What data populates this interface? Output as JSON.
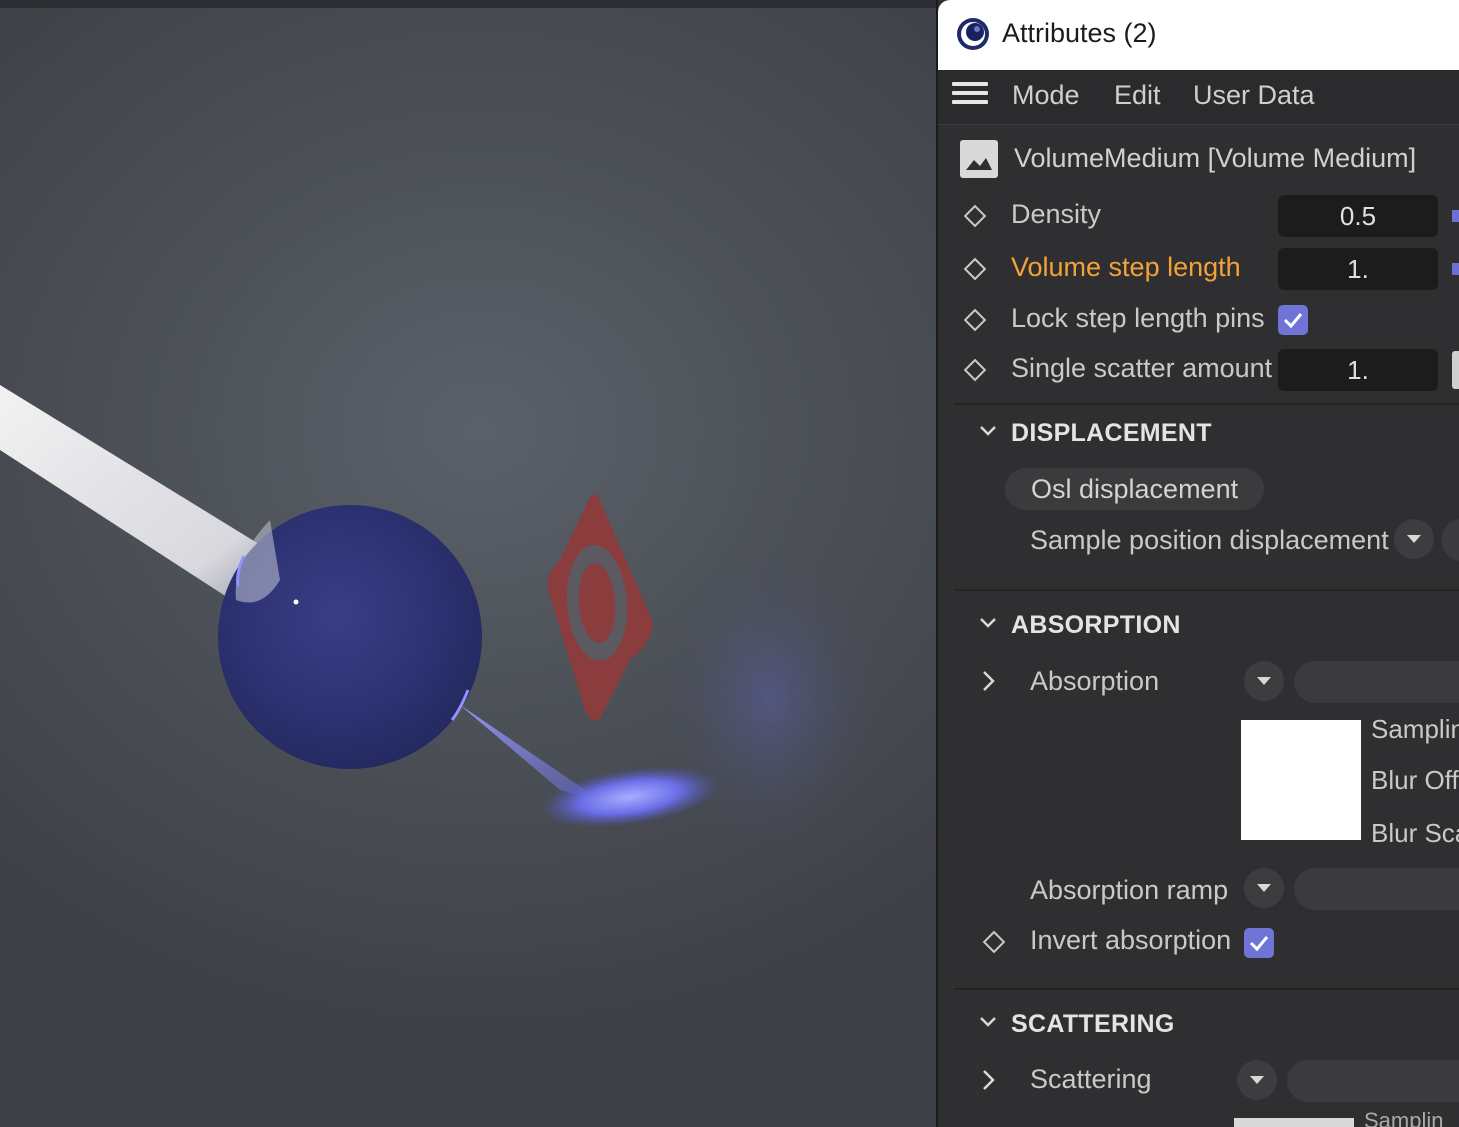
{
  "window": {
    "title": "Attributes (2)"
  },
  "menu": {
    "items": [
      "Mode",
      "Edit",
      "User Data"
    ]
  },
  "object": {
    "label": "VolumeMedium [Volume Medium]"
  },
  "properties": {
    "density": {
      "label": "Density",
      "value": "0.5"
    },
    "volume_step_length": {
      "label": "Volume step length",
      "value": "1."
    },
    "lock_step_length_pins": {
      "label": "Lock step length pins",
      "checked": true
    },
    "single_scatter_amount": {
      "label": "Single scatter amount",
      "value": "1."
    }
  },
  "displacement": {
    "title": "DISPLACEMENT",
    "osl_button": "Osl displacement",
    "sample_position": "Sample position displacement"
  },
  "absorption": {
    "title": "ABSORPTION",
    "absorption_label": "Absorption",
    "sampling": "Samplin",
    "blur_offset": "Blur Off",
    "blur_scale": "Blur Sca",
    "ramp_label": "Absorption ramp",
    "invert_label": "Invert absorption",
    "invert_checked": true
  },
  "scattering": {
    "title": "SCATTERING",
    "scattering_label": "Scattering",
    "sampling": "Samplin"
  },
  "colors": {
    "accent": "#f3a23a",
    "checkbox": "#6f74d6",
    "panel_bg": "#2f2f31"
  }
}
